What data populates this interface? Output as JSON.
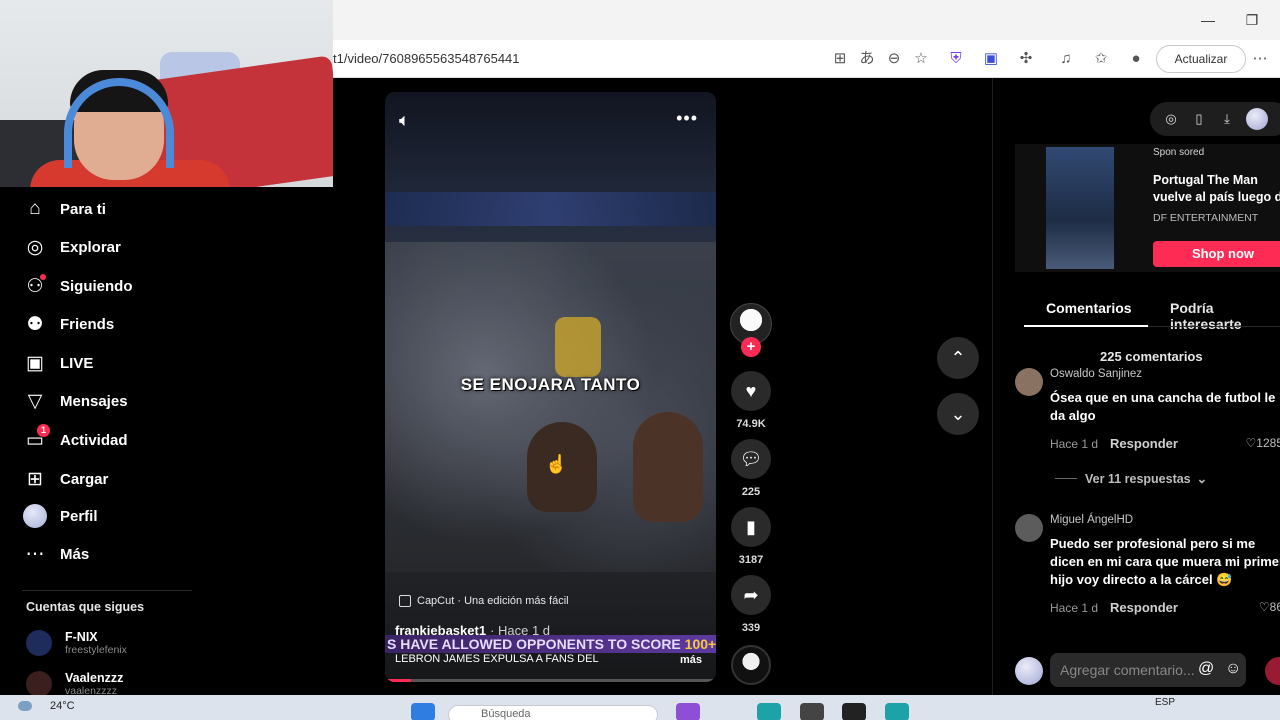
{
  "browser": {
    "url": "t1/video/7608965563548765441",
    "update_label": "Actualizar",
    "min_icon": "minimize-icon",
    "max_icon": "maximize-icon"
  },
  "sidebar": {
    "items": [
      {
        "label": "Para ti",
        "icon": "home-icon"
      },
      {
        "label": "Explorar",
        "icon": "compass-icon"
      },
      {
        "label": "Siguiendo",
        "icon": "following-icon"
      },
      {
        "label": "Friends",
        "icon": "friends-icon"
      },
      {
        "label": "LIVE",
        "icon": "live-icon"
      },
      {
        "label": "Mensajes",
        "icon": "send-icon"
      },
      {
        "label": "Actividad",
        "icon": "activity-icon",
        "badge": "1"
      },
      {
        "label": "Cargar",
        "icon": "upload-icon"
      },
      {
        "label": "Perfil",
        "icon": "profile-avatar"
      },
      {
        "label": "Más",
        "icon": "more-icon"
      }
    ],
    "following_title": "Cuentas que sigues",
    "accounts": [
      {
        "name": "F-NIX",
        "handle": "freestylefenix"
      },
      {
        "name": "Vaalenzzz",
        "handle": "vaalenzzzz"
      }
    ]
  },
  "video": {
    "overlay_caption": "SE ENOJARA TANTO",
    "capcut_label": "CapCut · Una edición más fácil",
    "author": "frankiebasket1",
    "posted": "· Hace 1 d",
    "ticker_text": "S HAVE ALLOWED OPPONENTS TO SCORE",
    "ticker_number": "100+",
    "description": "LEBRON JAMES EXPULSA A FANS DEL",
    "more_label": "más",
    "progress": 0.08
  },
  "actions": {
    "likes": "74.9K",
    "comments": "225",
    "saves": "3187",
    "shares": "339"
  },
  "ad": {
    "sponsored": "Spon sored",
    "title": "Portugal The Man vuelve al país luego d...",
    "brand": "DF ENTERTAINMENT",
    "cta": "Shop now"
  },
  "tabs": {
    "comments": "Comentarios",
    "suggested": "Podría interesarte"
  },
  "comments": {
    "count_label": "225 comentarios",
    "items": [
      {
        "user": "Oswaldo Sanjinez",
        "text": "Ósea que en una cancha de futbol le da algo",
        "time": "Hace 1 d",
        "reply": "Responder",
        "likes": "1285"
      },
      {
        "user": "Miguel ÁngelHD",
        "text": "Puedo ser profesional pero si me dicen en mi cara que muera mi primer hijo voy directo a la cárcel 😅",
        "time": "Hace 1 d",
        "reply": "Responder",
        "likes": "86"
      }
    ],
    "view_replies": "Ver 11 respuestas",
    "input_placeholder": "Agregar comentario..."
  },
  "taskbar": {
    "temperature": "24°C",
    "search_placeholder": "Búsqueda",
    "lang": "ESP"
  }
}
